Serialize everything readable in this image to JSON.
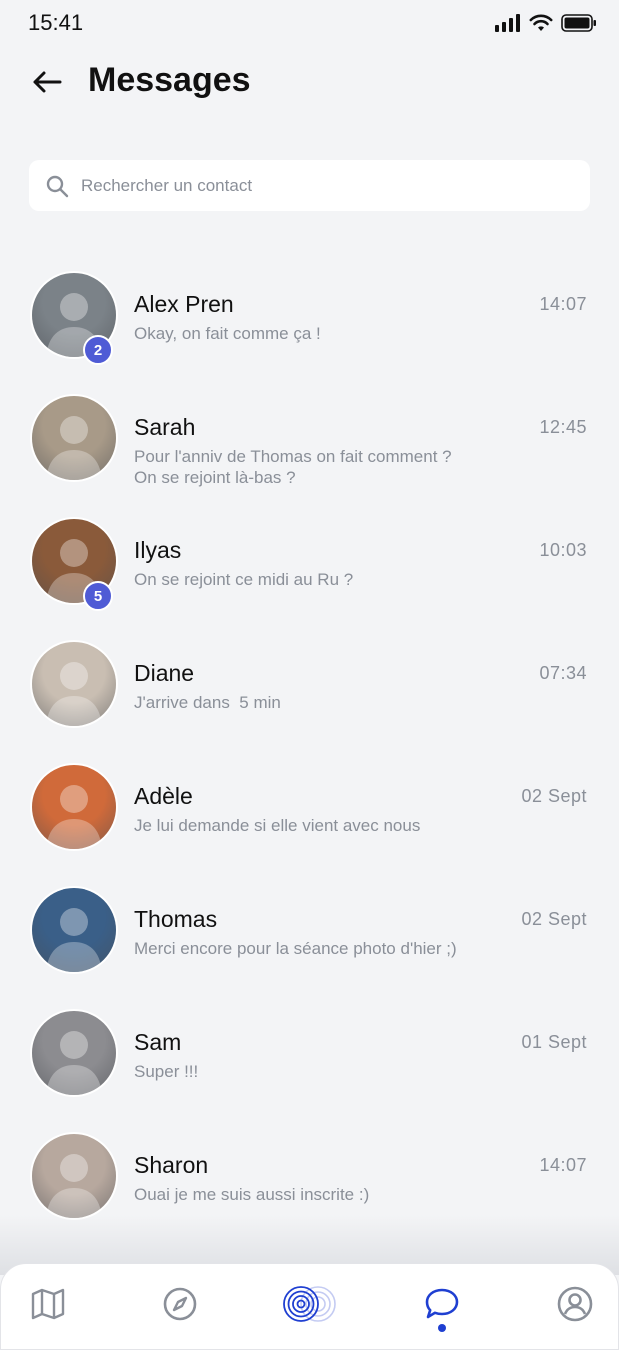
{
  "status_bar": {
    "time": "15:41"
  },
  "header": {
    "title": "Messages"
  },
  "search": {
    "placeholder": "Rechercher un contact"
  },
  "conversations": [
    {
      "name": "Alex Pren",
      "time": "14:07",
      "message": "Okay, on fait comme ça !",
      "unread": "2",
      "avatar_color": "#7b8288"
    },
    {
      "name": "Sarah",
      "time": "12:45",
      "message": "Pour l'anniv de Thomas on fait comment ?\nOn se rejoint là-bas ?",
      "unread": "",
      "avatar_color": "#a89a88"
    },
    {
      "name": "Ilyas",
      "time": "10:03",
      "message": "On se rejoint ce midi au Ru ?",
      "unread": "5",
      "avatar_color": "#8a5a3a"
    },
    {
      "name": "Diane",
      "time": "07:34",
      "message": "J'arrive dans  5 min",
      "unread": "",
      "avatar_color": "#c9beb2"
    },
    {
      "name": "Adèle",
      "time": "02 Sept",
      "message": "Je lui demande si elle vient avec nous",
      "unread": "",
      "avatar_color": "#d06a3a"
    },
    {
      "name": "Thomas",
      "time": "02 Sept",
      "message": "Merci encore pour la séance photo d'hier ;)",
      "unread": "",
      "avatar_color": "#3a5f88"
    },
    {
      "name": "Sam",
      "time": "01 Sept",
      "message": "Super !!!",
      "unread": "",
      "avatar_color": "#8c8c90"
    },
    {
      "name": "Sharon",
      "time": "14:07",
      "message": "Ouai je me suis aussi inscrite :)",
      "unread": "",
      "avatar_color": "#b7a89e"
    }
  ],
  "tab_bar": {
    "items": [
      "map-icon",
      "compass-icon",
      "radar-icon",
      "chat-icon",
      "profile-icon"
    ],
    "active": "chat-icon",
    "active_color": "#1f3fd1",
    "inactive_color": "#8a8f98"
  },
  "colors": {
    "badge": "#4f5bd5",
    "background": "#f3f4f6"
  }
}
